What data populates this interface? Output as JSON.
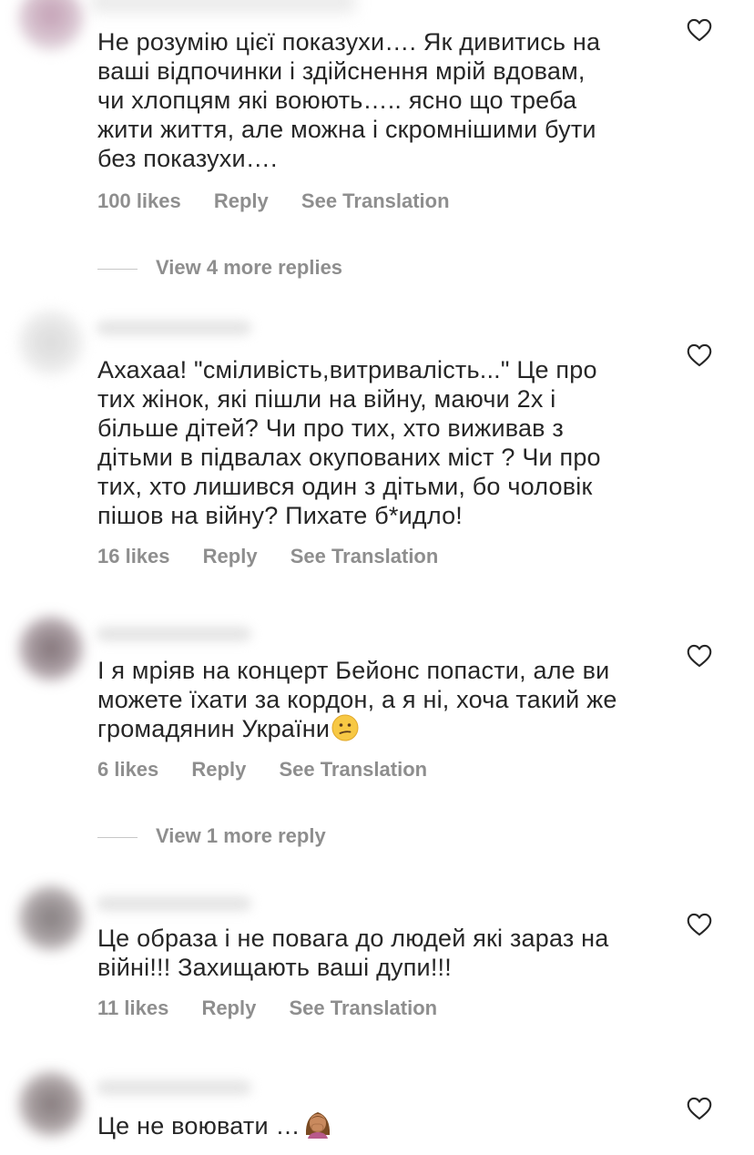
{
  "comments": [
    {
      "text": "Не розумію цієї показухи…. Як дивитись на\nваші відпочинки і здійснення мрій вдовам,\nчи хлопцям які воюють….. ясно що треба\nжити життя, але можна і скромнішими бути\nбез показухи….",
      "likes": "100 likes",
      "reply": "Reply",
      "translate": "See Translation",
      "view_more": "View 4 more replies"
    },
    {
      "text": "Ахахаа! \"сміливість,витривалість...\" Це про\nтих жінок, які пішли на війну, маючи 2х і\nбільше дітей? Чи про тих, хто виживав з\nдітьми  в підвалах окупованих міст ? Чи про\nтих, хто лишився один з дітьми, бо чоловік\nпішов на війну? Пихате б*идло!",
      "likes": "16 likes",
      "reply": "Reply",
      "translate": "See Translation"
    },
    {
      "text": "І я мріяв на концерт Бейонс попасти, але ви\nможете їхати за кордон, а я ні, хоча такий же\nгромадянин України",
      "emoji": "confused-face",
      "likes": "6 likes",
      "reply": "Reply",
      "translate": "See Translation",
      "view_more": "View 1 more reply"
    },
    {
      "text": "Це образа і не повага до людей які зараз на\nвійні!!! Захищають ваші дупи!!!",
      "likes": "11 likes",
      "reply": "Reply",
      "translate": "See Translation"
    },
    {
      "text": "Це не воювати …",
      "emoji": "woman-facepalming"
    }
  ],
  "colors": {
    "text": "#262626",
    "muted": "#8e8e8e",
    "divider": "#c7c7c7"
  },
  "icons": {
    "like": "heart-outline-icon"
  }
}
